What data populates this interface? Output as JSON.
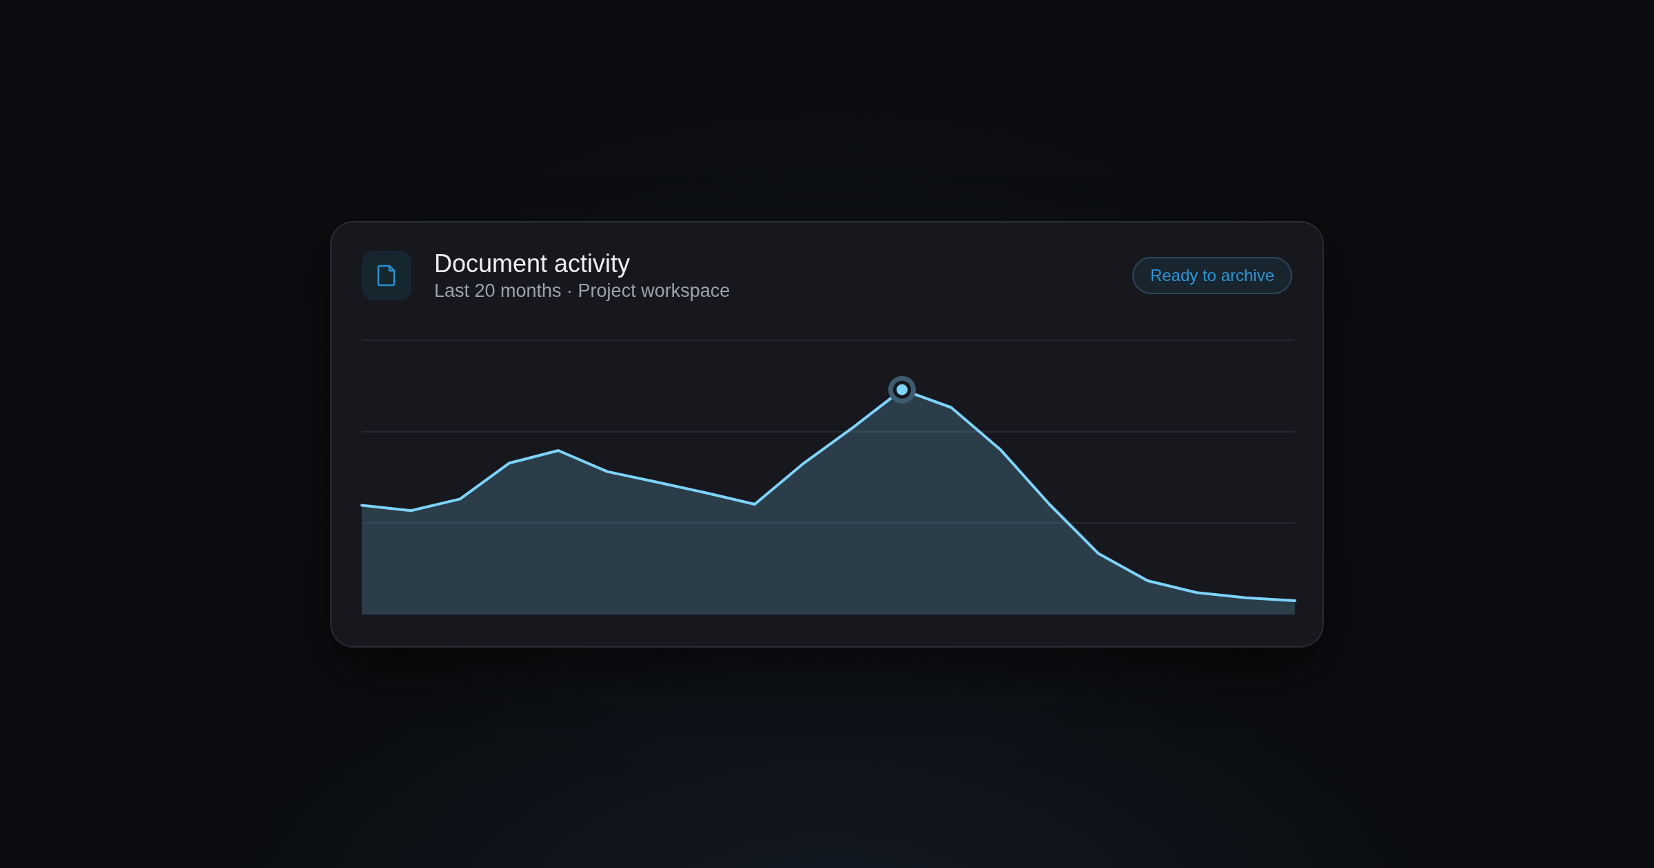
{
  "card": {
    "title": "Document activity",
    "subtitle": "Last 20 months · Project workspace",
    "badge": "Ready to archive"
  }
}
